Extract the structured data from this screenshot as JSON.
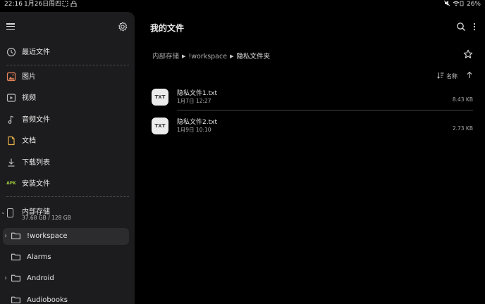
{
  "status_bar": {
    "time": "22:16",
    "date": "1月26日周四",
    "battery": "26%"
  },
  "sidebar": {
    "nav": [
      {
        "label": "最近文件",
        "icon": "clock-icon"
      },
      {
        "label": "图片",
        "icon": "image-icon"
      },
      {
        "label": "视频",
        "icon": "video-icon"
      },
      {
        "label": "音频文件",
        "icon": "music-note-icon"
      },
      {
        "label": "文档",
        "icon": "document-icon"
      },
      {
        "label": "下载列表",
        "icon": "download-icon"
      },
      {
        "label": "安装文件",
        "icon": "apk-icon",
        "icon_text": "APK"
      }
    ],
    "storage": {
      "title": "内部存储",
      "usage": "37.68 GB / 128 GB"
    },
    "folders": [
      {
        "label": "!workspace",
        "selected": true,
        "expandable": true
      },
      {
        "label": "Alarms",
        "selected": false,
        "expandable": false
      },
      {
        "label": "Android",
        "selected": false,
        "expandable": true
      },
      {
        "label": "Audiobooks",
        "selected": false,
        "expandable": false
      }
    ]
  },
  "main": {
    "title": "我的文件",
    "breadcrumb": [
      "内部存储",
      "!workspace",
      "隐私文件夹"
    ],
    "sort_label": "名称",
    "files": [
      {
        "thumb": "TXT",
        "name": "隐私文件1.txt",
        "date": "1月7日 12:27",
        "size": "8.43 KB"
      },
      {
        "thumb": "TXT",
        "name": "隐私文件2.txt",
        "date": "1月9日 10:10",
        "size": "2.73 KB"
      }
    ]
  },
  "colors": {
    "background": "#000000",
    "sidebar": "#1c1c1e",
    "selected": "#2c2c2e",
    "image_icon": "#e8845a",
    "document_icon": "#e8b04a",
    "apk_icon": "#9bc53d"
  }
}
